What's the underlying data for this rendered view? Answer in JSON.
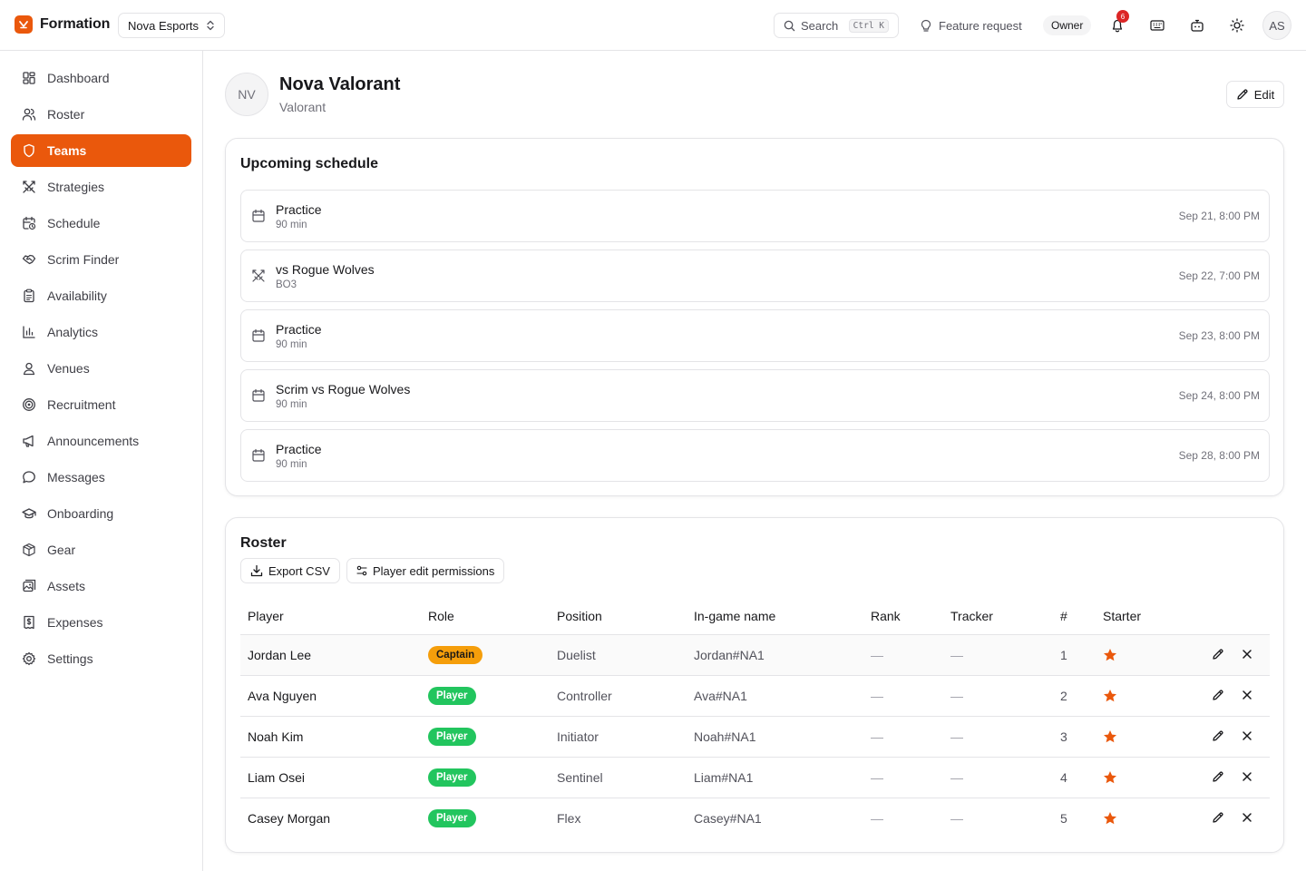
{
  "app": {
    "name": "Formation",
    "org": "Nova Esports",
    "accent": "#ea580c"
  },
  "topbar": {
    "search_label": "Search",
    "search_shortcut": "Ctrl K",
    "feature_label": "Feature request",
    "role_badge": "Owner",
    "notif_count": "6",
    "user_initials": "AS"
  },
  "sidebar": {
    "items": [
      {
        "label": "Dashboard",
        "icon": "dashboard-icon"
      },
      {
        "label": "Roster",
        "icon": "users-icon"
      },
      {
        "label": "Teams",
        "icon": "shield-icon",
        "active": true
      },
      {
        "label": "Strategies",
        "icon": "swords-icon"
      },
      {
        "label": "Schedule",
        "icon": "calendar-clock-icon"
      },
      {
        "label": "Scrim Finder",
        "icon": "handshake-icon"
      },
      {
        "label": "Availability",
        "icon": "clipboard-icon"
      },
      {
        "label": "Analytics",
        "icon": "bar-chart-icon"
      },
      {
        "label": "Venues",
        "icon": "map-pin-icon"
      },
      {
        "label": "Recruitment",
        "icon": "target-icon"
      },
      {
        "label": "Announcements",
        "icon": "megaphone-icon"
      },
      {
        "label": "Messages",
        "icon": "message-icon"
      },
      {
        "label": "Onboarding",
        "icon": "graduation-cap-icon"
      },
      {
        "label": "Gear",
        "icon": "package-icon"
      },
      {
        "label": "Assets",
        "icon": "image-icon"
      },
      {
        "label": "Expenses",
        "icon": "receipt-icon"
      },
      {
        "label": "Settings",
        "icon": "gear-icon"
      }
    ]
  },
  "team": {
    "initials": "NV",
    "name": "Nova Valorant",
    "game": "Valorant",
    "edit_label": "Edit"
  },
  "schedule": {
    "title": "Upcoming schedule",
    "events": [
      {
        "title": "Practice",
        "sub": "90 min",
        "date": "Sep 21, 8:00 PM",
        "icon": "calendar-icon"
      },
      {
        "title": "vs Rogue Wolves",
        "sub": "BO3",
        "date": "Sep 22, 7:00 PM",
        "icon": "swords-icon"
      },
      {
        "title": "Practice",
        "sub": "90 min",
        "date": "Sep 23, 8:00 PM",
        "icon": "calendar-icon"
      },
      {
        "title": "Scrim vs Rogue Wolves",
        "sub": "90 min",
        "date": "Sep 24, 8:00 PM",
        "icon": "calendar-icon"
      },
      {
        "title": "Practice",
        "sub": "90 min",
        "date": "Sep 28, 8:00 PM",
        "icon": "calendar-icon"
      }
    ]
  },
  "roster": {
    "title": "Roster",
    "export_label": "Export CSV",
    "permissions_label": "Player edit permissions",
    "columns": [
      "Player",
      "Role",
      "Position",
      "In-game name",
      "Rank",
      "Tracker",
      "#",
      "Starter"
    ],
    "rows": [
      {
        "player": "Jordan Lee",
        "role": "Captain",
        "position": "Duelist",
        "ign": "Jordan#NA1",
        "rank": "—",
        "tracker": "—",
        "number": "1",
        "starter": true
      },
      {
        "player": "Ava Nguyen",
        "role": "Player",
        "position": "Controller",
        "ign": "Ava#NA1",
        "rank": "—",
        "tracker": "—",
        "number": "2",
        "starter": true
      },
      {
        "player": "Noah Kim",
        "role": "Player",
        "position": "Initiator",
        "ign": "Noah#NA1",
        "rank": "—",
        "tracker": "—",
        "number": "3",
        "starter": true
      },
      {
        "player": "Liam Osei",
        "role": "Player",
        "position": "Sentinel",
        "ign": "Liam#NA1",
        "rank": "—",
        "tracker": "—",
        "number": "4",
        "starter": true
      },
      {
        "player": "Casey Morgan",
        "role": "Player",
        "position": "Flex",
        "ign": "Casey#NA1",
        "rank": "—",
        "tracker": "—",
        "number": "5",
        "starter": true
      }
    ]
  }
}
